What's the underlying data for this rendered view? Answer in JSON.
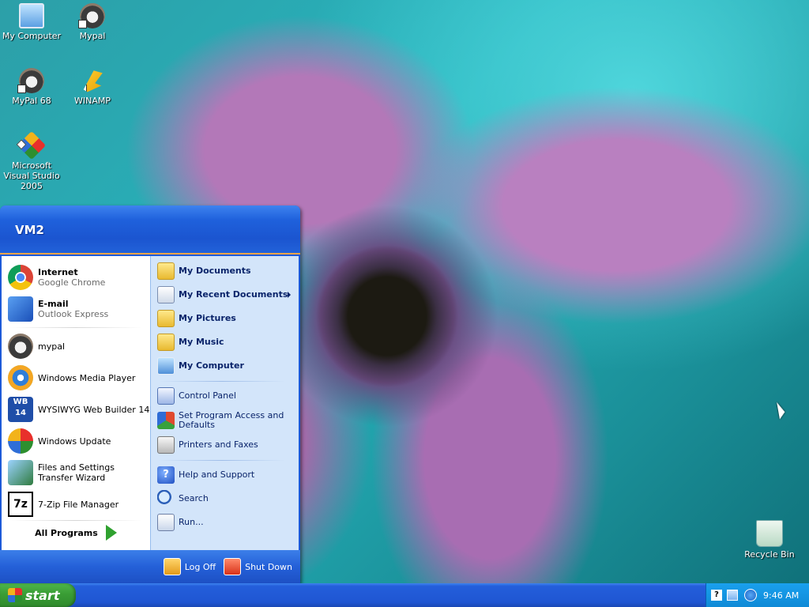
{
  "desktop": {
    "icons": [
      {
        "label": "My Computer",
        "icon": "my-computer-icon"
      },
      {
        "label": "Mypal",
        "icon": "mypal-icon"
      },
      {
        "label": "MyPal 68",
        "icon": "mypal-icon"
      },
      {
        "label": "WINAMP",
        "icon": "winamp-icon"
      },
      {
        "label": "Microsoft Visual Studio 2005",
        "icon": "visual-studio-icon"
      },
      {
        "label": "Recycle Bin",
        "icon": "recycle-bin-icon"
      }
    ]
  },
  "start_menu": {
    "user": "VM2",
    "pinned": [
      {
        "title": "Internet",
        "subtitle": "Google Chrome",
        "icon": "chrome-icon"
      },
      {
        "title": "E-mail",
        "subtitle": "Outlook Express",
        "icon": "outlook-express-icon"
      }
    ],
    "recent": [
      {
        "label": "mypal",
        "icon": "mypal-icon"
      },
      {
        "label": "Windows Media Player",
        "icon": "windows-media-player-icon"
      },
      {
        "label": "WYSIWYG Web Builder 14",
        "icon": "web-builder-icon",
        "icon_text": "WB 14"
      },
      {
        "label": "Windows Update",
        "icon": "windows-update-icon"
      },
      {
        "label": "Files and Settings Transfer Wizard",
        "icon": "transfer-wizard-icon"
      },
      {
        "label": "7-Zip File Manager",
        "icon": "7zip-icon",
        "icon_text": "7z"
      }
    ],
    "all_programs": "All Programs",
    "places": [
      {
        "label": "My Documents",
        "icon": "folder-icon"
      },
      {
        "label": "My Recent Documents",
        "icon": "recent-documents-icon"
      },
      {
        "label": "My Pictures",
        "icon": "folder-icon"
      },
      {
        "label": "My Music",
        "icon": "folder-icon"
      },
      {
        "label": "My Computer",
        "icon": "my-computer-icon"
      }
    ],
    "settings": [
      {
        "label": "Control Panel",
        "icon": "control-panel-icon"
      },
      {
        "label": "Set Program Access and Defaults",
        "icon": "program-access-icon"
      },
      {
        "label": "Printers and Faxes",
        "icon": "printer-icon"
      }
    ],
    "tools": [
      {
        "label": "Help and Support",
        "icon": "help-icon",
        "icon_text": "?"
      },
      {
        "label": "Search",
        "icon": "search-icon"
      },
      {
        "label": "Run...",
        "icon": "run-icon"
      }
    ],
    "log_off": "Log Off",
    "shut_down": "Shut Down"
  },
  "taskbar": {
    "start_label": "start",
    "tray_help_icon_text": "?",
    "clock": "9:46 AM"
  }
}
